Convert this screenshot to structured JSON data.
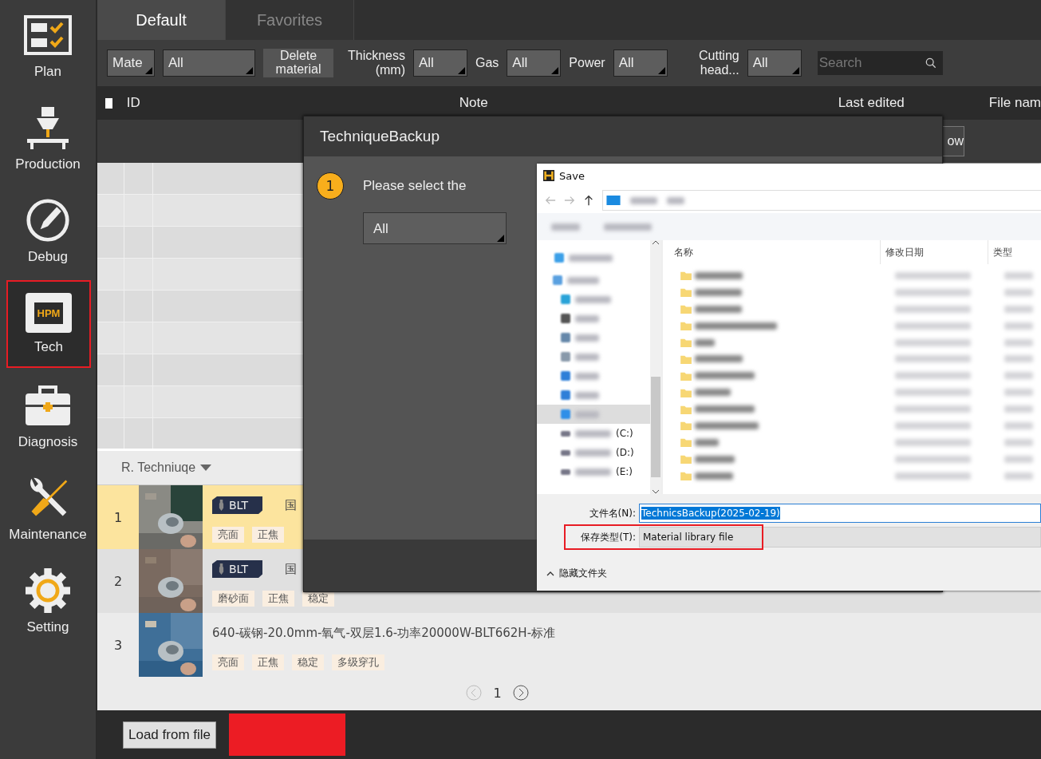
{
  "sidebar": {
    "items": [
      {
        "label": "Plan",
        "selected": false
      },
      {
        "label": "Production",
        "selected": false
      },
      {
        "label": "Debug",
        "selected": false
      },
      {
        "label": "Tech",
        "badge": "HPM",
        "selected": true
      },
      {
        "label": "Diagnosis",
        "selected": false
      },
      {
        "label": "Maintenance",
        "selected": false
      },
      {
        "label": "Setting",
        "selected": false
      }
    ]
  },
  "tabs": [
    {
      "label": "Default",
      "selected": true
    },
    {
      "label": "Favorites",
      "selected": false
    }
  ],
  "filters": [
    {
      "kind": "dropdown",
      "value": "Mate"
    },
    {
      "kind": "dropdown",
      "value": "All"
    },
    {
      "kind": "button",
      "label": "Delete material"
    },
    {
      "kind": "label",
      "label": "Thickness (mm)"
    },
    {
      "kind": "dropdown",
      "value": "All"
    },
    {
      "kind": "label",
      "label": "Gas"
    },
    {
      "kind": "dropdown",
      "value": "All"
    },
    {
      "kind": "label",
      "label": "Power"
    },
    {
      "kind": "dropdown",
      "value": "All"
    },
    {
      "kind": "label",
      "label": "Cutting head..."
    },
    {
      "kind": "dropdown",
      "value": "All"
    },
    {
      "kind": "search",
      "placeholder": "Search"
    }
  ],
  "table": {
    "select_all_checked": false,
    "columns": [
      "ID",
      "Note",
      "Last edited",
      "File nam"
    ],
    "partial_button": "ow"
  },
  "technique_list": {
    "sort_label": "R. Techniuqe",
    "rows": [
      {
        "index": "1",
        "selected": true,
        "brand": "BLT",
        "title": "国",
        "tags": [
          "亮面",
          "正焦"
        ]
      },
      {
        "index": "2",
        "selected": false,
        "brand": "BLT",
        "title": "国",
        "tags": [
          "磨砂面",
          "正焦",
          "稳定"
        ]
      },
      {
        "index": "3",
        "selected": false,
        "title": "640-碳钢-20.0mm-氧气-双层1.6-功率20000W-BLT662H-标准",
        "tags": [
          "亮面",
          "正焦",
          "稳定",
          "多级穿孔"
        ]
      }
    ]
  },
  "pagination": {
    "page": "1"
  },
  "bottom_bar": {
    "load_button": "Load from file"
  },
  "backup_dialog": {
    "title": "TechniqueBackup",
    "step": "1",
    "prompt": "Please select the",
    "select": "All"
  },
  "save_dialog": {
    "title": "Save",
    "columns": [
      "名称",
      "修改日期",
      "类型"
    ],
    "drives": [
      "(C:)",
      "(D:)",
      "(E:)"
    ],
    "file_name_label": "文件名(N):",
    "file_name": "TechnicsBackup(2025-02-19)",
    "type_label": "保存类型(T):",
    "type": "Material library file",
    "hide_folders": "隐藏文件夹"
  }
}
